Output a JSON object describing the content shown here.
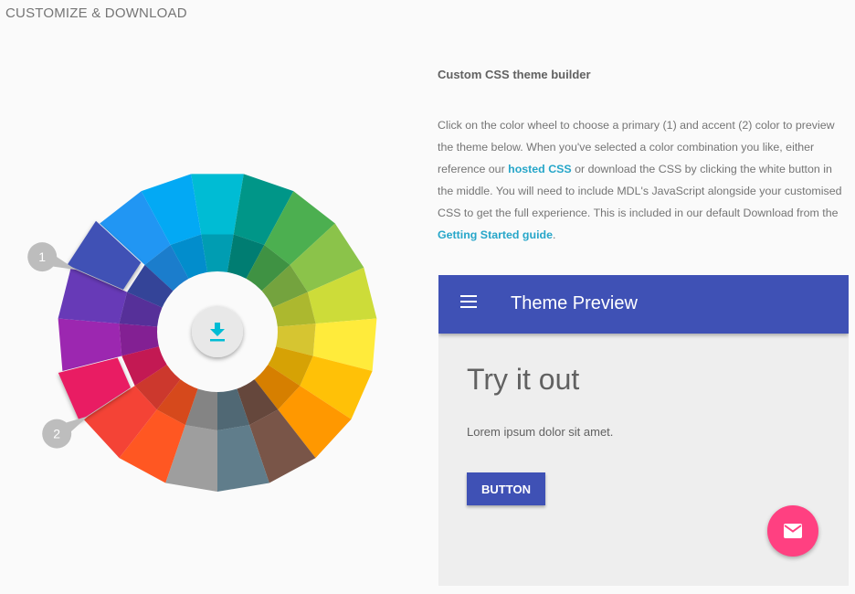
{
  "page": {
    "section_title": "CUSTOMIZE & DOWNLOAD"
  },
  "wheel": {
    "colors": [
      "#00bcd4",
      "#009688",
      "#4caf50",
      "#8bc34a",
      "#cddc39",
      "#ffeb3b",
      "#ffc107",
      "#ff9800",
      "#795548",
      "#607d8b",
      "#9e9e9e",
      "#ff5722",
      "#f44336",
      "#e91e63",
      "#9c27b0",
      "#673ab7",
      "#3f51b5",
      "#2196f3",
      "#03a9f4"
    ],
    "primary_index": 16,
    "accent_index": 13,
    "markers": {
      "primary": "1",
      "accent": "2"
    },
    "download_icon": "download-icon"
  },
  "builder": {
    "title": "Custom CSS theme builder",
    "text1": "Click on the color wheel to choose a primary (1) and accent (2) color to preview the theme below. When you've selected a color combination you like, either reference our ",
    "link1": "hosted CSS",
    "text2": " or download the CSS by clicking the white button in the middle. You will need to include MDL's JavaScript alongside your customised CSS to get the full experience. This is included in our default Download from the ",
    "link2": "Getting Started guide",
    "text3": "."
  },
  "preview": {
    "title": "Theme Preview",
    "menu_icon": "menu-icon",
    "heading": "Try it out",
    "body": "Lorem ipsum dolor sit amet.",
    "button_label": "BUTTON",
    "fab_icon": "mail-icon",
    "primary_color": "#3f51b5",
    "accent_color": "#ff4081"
  }
}
